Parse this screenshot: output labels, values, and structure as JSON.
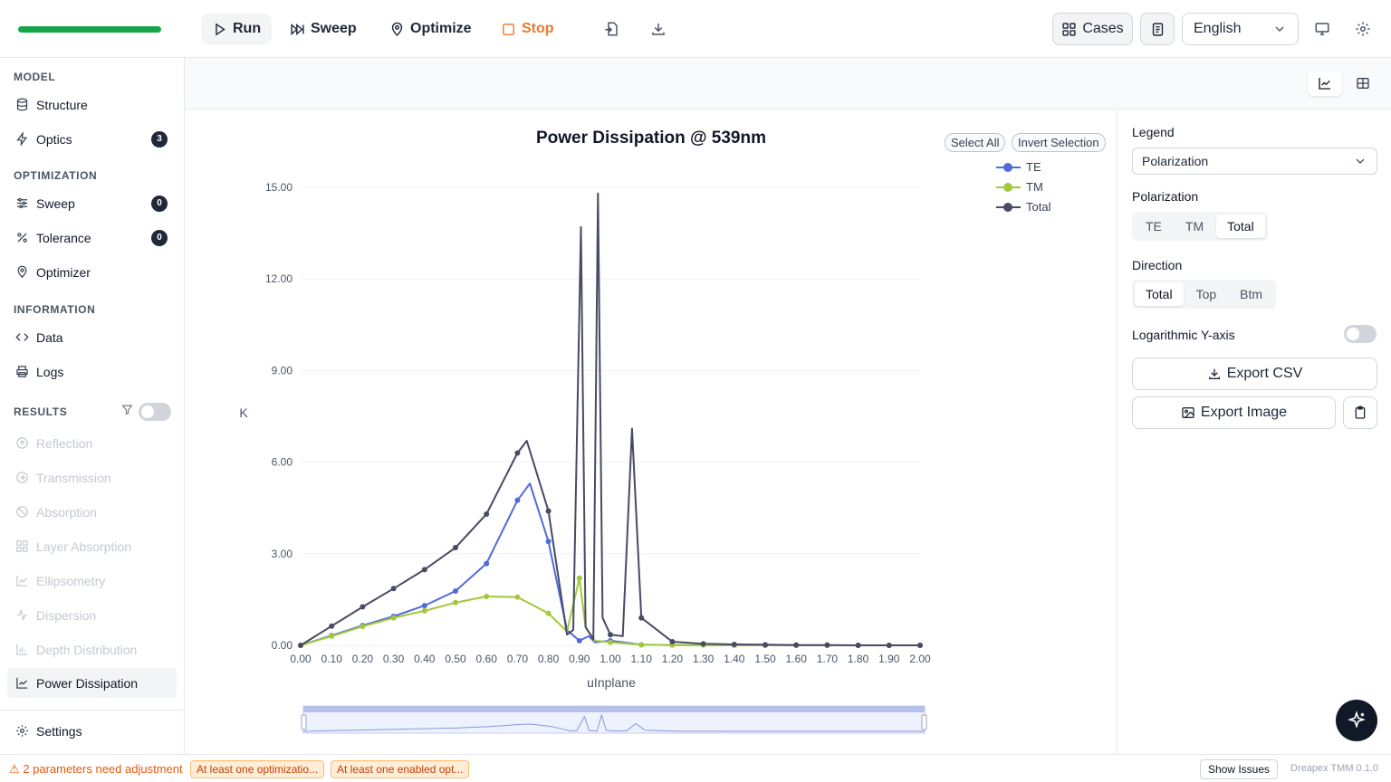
{
  "toolbar": {
    "run": "Run",
    "sweep": "Sweep",
    "optimize": "Optimize",
    "stop": "Stop",
    "cases": "Cases",
    "language": "English",
    "progress": 1.0
  },
  "sidebar": {
    "model_title": "MODEL",
    "structure": "Structure",
    "optics": "Optics",
    "optics_badge": "3",
    "optimization_title": "OPTIMIZATION",
    "sweep": "Sweep",
    "sweep_badge": "0",
    "tolerance": "Tolerance",
    "tolerance_badge": "0",
    "optimizer": "Optimizer",
    "information_title": "INFORMATION",
    "data": "Data",
    "logs": "Logs",
    "results_title": "RESULTS",
    "results": [
      {
        "label": "Reflection"
      },
      {
        "label": "Transmission"
      },
      {
        "label": "Absorption"
      },
      {
        "label": "Layer Absorption"
      },
      {
        "label": "Ellipsometry"
      },
      {
        "label": "Dispersion"
      },
      {
        "label": "Depth Distribution"
      },
      {
        "label": "Power Dissipation"
      }
    ],
    "settings": "Settings"
  },
  "chart_buttons": {
    "select_all": "Select All",
    "invert_selection": "Invert Selection"
  },
  "chart_data": {
    "type": "line",
    "title": "Power Dissipation @ 539nm",
    "xlabel": "uInplane",
    "ylabel": "K",
    "xlim": [
      0,
      2
    ],
    "ylim": [
      0,
      15
    ],
    "x_ticks": [
      "0.00",
      "0.10",
      "0.20",
      "0.30",
      "0.40",
      "0.50",
      "0.60",
      "0.70",
      "0.80",
      "0.90",
      "1.00",
      "1.10",
      "1.20",
      "1.30",
      "1.40",
      "1.50",
      "1.60",
      "1.70",
      "1.80",
      "1.90",
      "2.00"
    ],
    "y_ticks": [
      "0.00",
      "3.00",
      "6.00",
      "9.00",
      "12.00",
      "15.00"
    ],
    "legend_position": "top-right",
    "grid": true,
    "series": [
      {
        "name": "TE",
        "color": "#4f6bdc",
        "points": [
          [
            0,
            0
          ],
          [
            0.1,
            0.32
          ],
          [
            0.2,
            0.65
          ],
          [
            0.3,
            0.95
          ],
          [
            0.4,
            1.3
          ],
          [
            0.5,
            1.78
          ],
          [
            0.6,
            2.68
          ],
          [
            0.7,
            4.75
          ],
          [
            0.74,
            5.3
          ],
          [
            0.8,
            3.4
          ],
          [
            0.86,
            0.5
          ],
          [
            0.9,
            0.15
          ],
          [
            0.93,
            0.3
          ],
          [
            0.95,
            0.1
          ],
          [
            1.0,
            0.15
          ],
          [
            1.1,
            0.02
          ],
          [
            1.2,
            0.01
          ],
          [
            1.3,
            0.01
          ],
          [
            1.4,
            0.01
          ],
          [
            1.5,
            0.0
          ],
          [
            1.6,
            0.0
          ],
          [
            1.7,
            0.0
          ],
          [
            1.8,
            0.0
          ],
          [
            1.9,
            0.0
          ],
          [
            2.0,
            0.0
          ]
        ]
      },
      {
        "name": "TM",
        "color": "#a3c93a",
        "points": [
          [
            0,
            0
          ],
          [
            0.1,
            0.3
          ],
          [
            0.2,
            0.62
          ],
          [
            0.3,
            0.9
          ],
          [
            0.4,
            1.13
          ],
          [
            0.5,
            1.4
          ],
          [
            0.6,
            1.6
          ],
          [
            0.7,
            1.58
          ],
          [
            0.8,
            1.05
          ],
          [
            0.86,
            0.45
          ],
          [
            0.9,
            2.2
          ],
          [
            0.92,
            0.6
          ],
          [
            0.95,
            0.15
          ],
          [
            1.0,
            0.1
          ],
          [
            1.1,
            0.02
          ],
          [
            1.2,
            0.01
          ],
          [
            1.3,
            0.01
          ],
          [
            1.4,
            0.0
          ],
          [
            1.5,
            0.0
          ],
          [
            1.6,
            0.0
          ],
          [
            1.7,
            0.0
          ],
          [
            1.8,
            0.0
          ],
          [
            1.9,
            0.0
          ],
          [
            2.0,
            0.0
          ]
        ]
      },
      {
        "name": "Total",
        "color": "#474b63",
        "points": [
          [
            0,
            0
          ],
          [
            0.1,
            0.63
          ],
          [
            0.2,
            1.26
          ],
          [
            0.3,
            1.86
          ],
          [
            0.4,
            2.48
          ],
          [
            0.5,
            3.2
          ],
          [
            0.6,
            4.3
          ],
          [
            0.7,
            6.3
          ],
          [
            0.73,
            6.7
          ],
          [
            0.8,
            4.4
          ],
          [
            0.86,
            0.35
          ],
          [
            0.88,
            0.5
          ],
          [
            0.905,
            13.7
          ],
          [
            0.92,
            0.6
          ],
          [
            0.945,
            0.2
          ],
          [
            0.96,
            14.8
          ],
          [
            0.975,
            0.9
          ],
          [
            1.0,
            0.35
          ],
          [
            1.04,
            0.3
          ],
          [
            1.07,
            7.1
          ],
          [
            1.1,
            0.9
          ],
          [
            1.2,
            0.12
          ],
          [
            1.3,
            0.05
          ],
          [
            1.4,
            0.03
          ],
          [
            1.5,
            0.02
          ],
          [
            1.6,
            0.01
          ],
          [
            1.7,
            0.01
          ],
          [
            1.8,
            0.0
          ],
          [
            1.9,
            0.0
          ],
          [
            2.0,
            0.0
          ]
        ]
      }
    ]
  },
  "panel": {
    "legend_label": "Legend",
    "legend_value": "Polarization",
    "polarization_label": "Polarization",
    "pol_options": [
      "TE",
      "TM",
      "Total"
    ],
    "pol_selected": "Total",
    "direction_label": "Direction",
    "dir_options": [
      "Total",
      "Top",
      "Btm"
    ],
    "dir_selected": "Total",
    "log_label": "Logarithmic Y-axis",
    "export_csv": "Export CSV",
    "export_image": "Export Image"
  },
  "status": {
    "warning": "⚠ 2 parameters need adjustment",
    "chip1": "At least one optimizatio...",
    "chip2": "At least one enabled opt...",
    "show_issues": "Show Issues",
    "version": "Dreapex TMM 0.1.0"
  }
}
